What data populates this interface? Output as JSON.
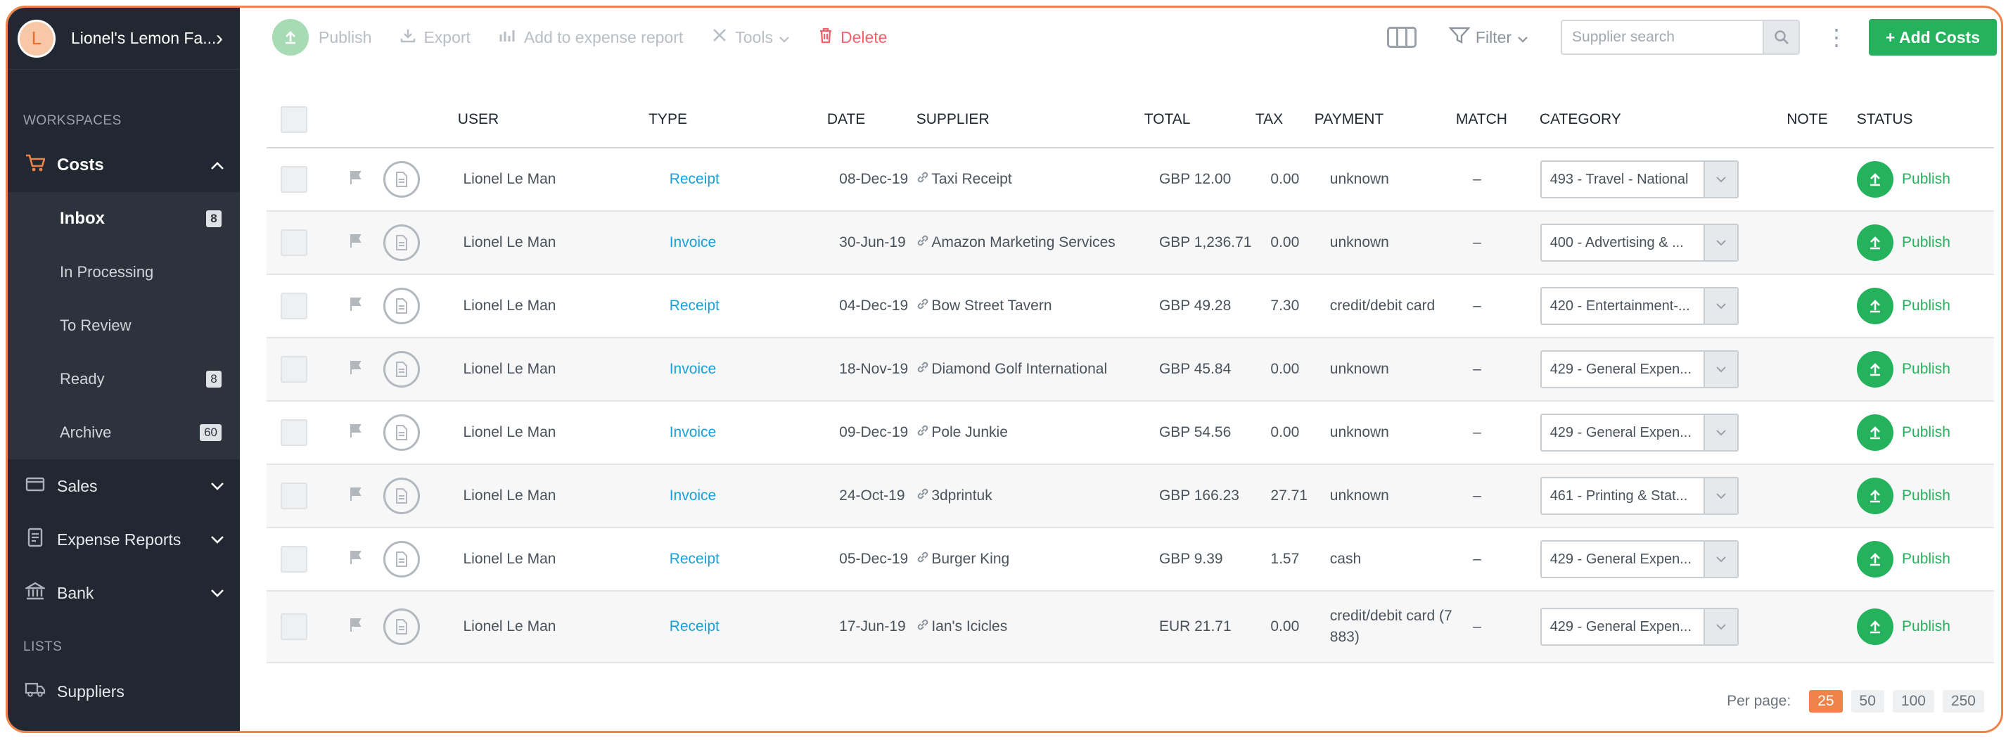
{
  "org": {
    "initial": "L",
    "name": "Lionel's Lemon Fa..."
  },
  "sidebar": {
    "workspaces_label": "WORKSPACES",
    "costs_label": "Costs",
    "costs_sub": [
      {
        "label": "Inbox",
        "count": "8"
      },
      {
        "label": "In Processing",
        "count": ""
      },
      {
        "label": "To Review",
        "count": ""
      },
      {
        "label": "Ready",
        "count": "8"
      },
      {
        "label": "Archive",
        "count": "60"
      }
    ],
    "sales_label": "Sales",
    "expense_reports_label": "Expense Reports",
    "bank_label": "Bank",
    "lists_label": "LISTS",
    "suppliers_label": "Suppliers"
  },
  "toolbar": {
    "publish": "Publish",
    "export": "Export",
    "add_to_expense_report": "Add to expense report",
    "tools": "Tools",
    "delete": "Delete",
    "filter": "Filter",
    "search_placeholder": "Supplier search",
    "add_costs": "+ Add Costs"
  },
  "table": {
    "headers": {
      "user": "USER",
      "type": "TYPE",
      "date": "DATE",
      "supplier": "SUPPLIER",
      "total": "TOTAL",
      "tax": "TAX",
      "payment": "PAYMENT",
      "match": "MATCH",
      "category": "CATEGORY",
      "note": "NOTE",
      "status": "STATUS"
    },
    "rows": [
      {
        "user": "Lionel Le Man",
        "type": "Receipt",
        "date": "08-Dec-19",
        "supplier": "Taxi Receipt",
        "total": "GBP 12.00",
        "tax": "0.00",
        "payment": "unknown",
        "match": "–",
        "category": "493 - Travel - National",
        "status": "Publish"
      },
      {
        "user": "Lionel Le Man",
        "type": "Invoice",
        "date": "30-Jun-19",
        "supplier": "Amazon Marketing Services",
        "total": "GBP 1,236.71",
        "tax": "0.00",
        "payment": "unknown",
        "match": "–",
        "category": "400 - Advertising & ...",
        "status": "Publish"
      },
      {
        "user": "Lionel Le Man",
        "type": "Receipt",
        "date": "04-Dec-19",
        "supplier": "Bow Street Tavern",
        "total": "GBP 49.28",
        "tax": "7.30",
        "payment": "credit/debit card",
        "match": "–",
        "category": "420 - Entertainment-...",
        "status": "Publish"
      },
      {
        "user": "Lionel Le Man",
        "type": "Invoice",
        "date": "18-Nov-19",
        "supplier": "Diamond Golf International",
        "total": "GBP 45.84",
        "tax": "0.00",
        "payment": "unknown",
        "match": "–",
        "category": "429 - General Expen...",
        "status": "Publish"
      },
      {
        "user": "Lionel Le Man",
        "type": "Invoice",
        "date": "09-Dec-19",
        "supplier": "Pole Junkie",
        "total": "GBP 54.56",
        "tax": "0.00",
        "payment": "unknown",
        "match": "–",
        "category": "429 - General Expen...",
        "status": "Publish"
      },
      {
        "user": "Lionel Le Man",
        "type": "Invoice",
        "date": "24-Oct-19",
        "supplier": "3dprintuk",
        "total": "GBP 166.23",
        "tax": "27.71",
        "payment": "unknown",
        "match": "–",
        "category": "461 - Printing & Stat...",
        "status": "Publish"
      },
      {
        "user": "Lionel Le Man",
        "type": "Receipt",
        "date": "05-Dec-19",
        "supplier": "Burger King",
        "total": "GBP 9.39",
        "tax": "1.57",
        "payment": "cash",
        "match": "–",
        "category": "429 - General Expen...",
        "status": "Publish"
      },
      {
        "user": "Lionel Le Man",
        "type": "Receipt",
        "date": "17-Jun-19",
        "supplier": "Ian's Icicles",
        "total": "EUR 21.71",
        "tax": "0.00",
        "payment": "credit/debit card (7 883)",
        "match": "–",
        "category": "429 - General Expen...",
        "status": "Publish"
      }
    ]
  },
  "pagination": {
    "label": "Per page:",
    "options": [
      "25",
      "50",
      "100",
      "250"
    ],
    "selected": "25"
  },
  "colors": {
    "accent": "#f0834a",
    "green": "#25b25c",
    "link": "#1aa0d8",
    "danger": "#f1616b",
    "sidebar": "#222831"
  },
  "icons": {
    "costs": "cart-icon",
    "sales": "wallet-icon",
    "expense_reports": "report-icon",
    "bank": "bank-icon",
    "suppliers": "truck-icon",
    "flag": "flag-icon",
    "document": "document-icon",
    "link": "link-icon",
    "publish": "upload-icon"
  }
}
